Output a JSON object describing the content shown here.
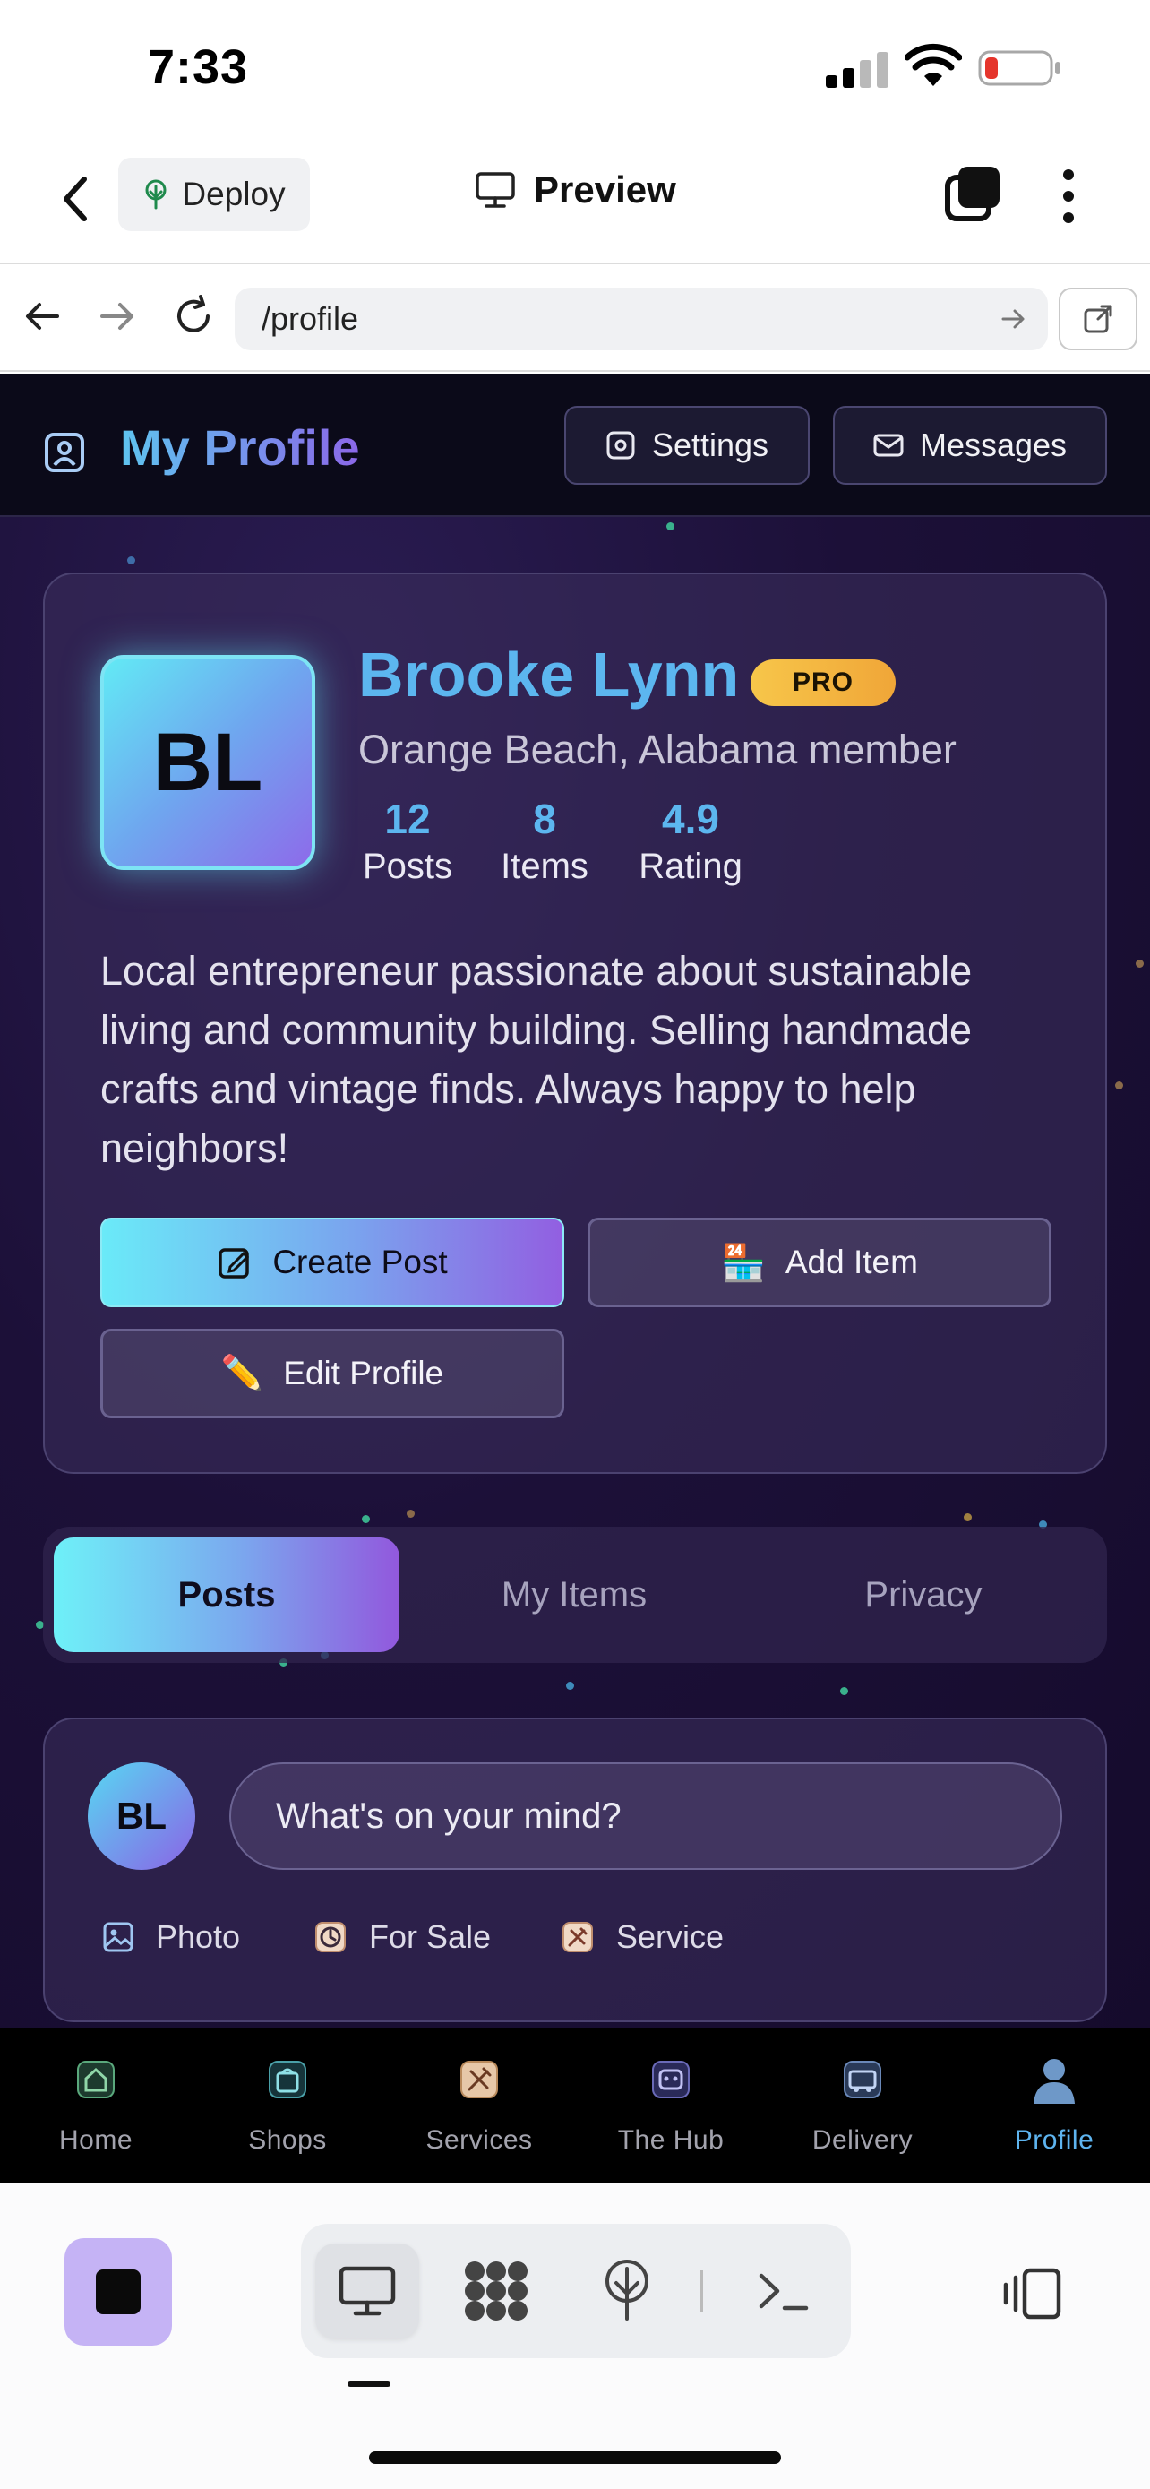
{
  "status_bar": {
    "time": "7:33"
  },
  "app_bar": {
    "deploy_label": "Deploy",
    "title": "Preview"
  },
  "browser": {
    "url": "/profile"
  },
  "header": {
    "title": "My Profile",
    "settings_label": "Settings",
    "messages_label": "Messages"
  },
  "profile": {
    "initials": "BL",
    "name": "Brooke Lynn",
    "badge": "PRO",
    "location": "Orange Beach, Alabama member",
    "stats": [
      {
        "value": "12",
        "label": "Posts"
      },
      {
        "value": "8",
        "label": "Items"
      },
      {
        "value": "4.9",
        "label": "Rating"
      }
    ],
    "bio": "Local entrepreneur passionate about sustainable living and community building. Selling handmade crafts and vintage finds. Always happy to help neighbors!"
  },
  "actions": {
    "create_post": "Create Post",
    "add_item": "Add Item",
    "edit_profile": "Edit Profile"
  },
  "tabs": [
    {
      "label": "Posts",
      "active": true
    },
    {
      "label": "My Items"
    },
    {
      "label": "Privacy"
    }
  ],
  "composer": {
    "initials": "BL",
    "placeholder": "What's on your mind?",
    "options": [
      {
        "label": "Photo"
      },
      {
        "label": "For Sale"
      },
      {
        "label": "Service"
      }
    ]
  },
  "bottom_nav": [
    {
      "label": "Home",
      "icon": "home-icon"
    },
    {
      "label": "Shops",
      "icon": "shop-bag-icon"
    },
    {
      "label": "Services",
      "icon": "services-icon"
    },
    {
      "label": "The Hub",
      "icon": "hub-icon"
    },
    {
      "label": "Delivery",
      "icon": "delivery-icon"
    },
    {
      "label": "Profile",
      "icon": "profile-icon",
      "active": true
    }
  ],
  "colors": {
    "accent": "#5cb6ef",
    "gradient_start": "#6aeaf8",
    "gradient_end": "#925fe1",
    "pro_badge": "#f7c64a",
    "app_bg": "#1c1038"
  }
}
